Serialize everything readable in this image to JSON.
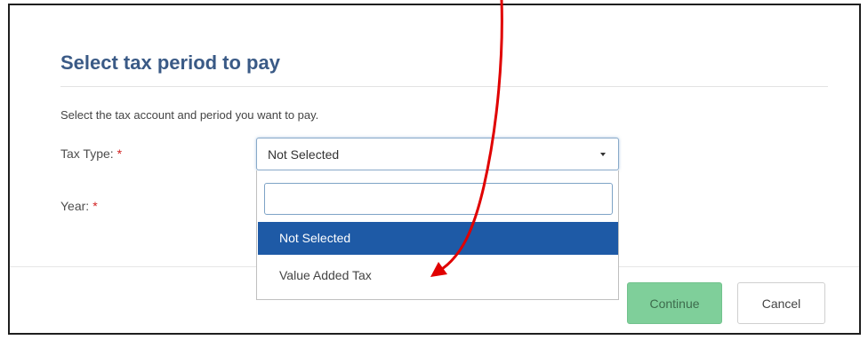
{
  "dialog": {
    "title": "Select tax period to pay",
    "instructions": "Select the tax account and period you want to pay.",
    "continue_label": "Continue",
    "cancel_label": "Cancel"
  },
  "form": {
    "tax_type": {
      "label": "Tax Type:",
      "required_mark": "*",
      "selected_value": "Not Selected",
      "open": true
    },
    "year": {
      "label": "Year:",
      "required_mark": "*"
    }
  },
  "dropdown": {
    "search_value": "",
    "options": [
      {
        "label": "Not Selected",
        "highlighted": true
      },
      {
        "label": "Value Added Tax",
        "highlighted": false
      }
    ]
  },
  "colors": {
    "title": "#3a5a86",
    "required": "#d11f1f",
    "highlight": "#1e5aa6",
    "continue_button": "#7fcf9a",
    "annotation_arrow": "#e00000"
  }
}
